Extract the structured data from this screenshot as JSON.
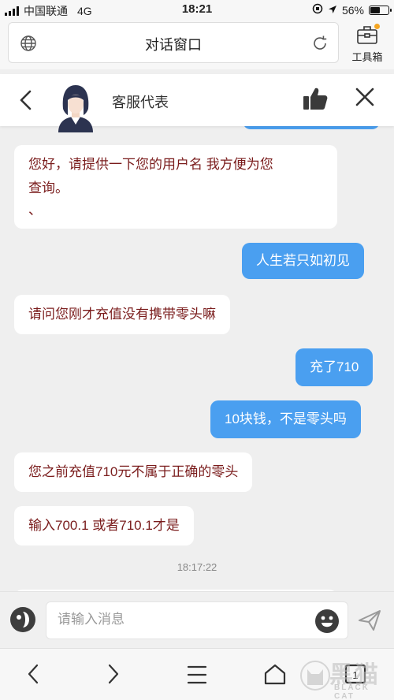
{
  "status_bar": {
    "carrier": "中国联通",
    "network": "4G",
    "time": "18:21",
    "battery": "56%",
    "battery_level": 0.56
  },
  "browser": {
    "title": "对话窗口",
    "toolbox_label": "工具箱"
  },
  "chat_header": {
    "agent_name": "客服代表"
  },
  "messages": [
    {
      "sender": "agent",
      "lines": [
        "您好，请提供一下您的用户名 我方便为您",
        "查询。",
        "、"
      ]
    },
    {
      "sender": "user",
      "text": "人生若只如初见"
    },
    {
      "sender": "agent",
      "text": "请问您刚才充值没有携带零头嘛"
    },
    {
      "sender": "user",
      "text": "充了710"
    },
    {
      "sender": "user",
      "text": "10块钱，不是零头吗"
    },
    {
      "sender": "agent",
      "text": "您之前充值710元不属于正确的零头"
    },
    {
      "sender": "agent",
      "text": "输入700.1 或者710.1才是"
    }
  ],
  "timestamp": "18:17:22",
  "input": {
    "placeholder": "请输入消息"
  },
  "watermark": {
    "cn": "黑猫",
    "en": "BLACK CAT"
  },
  "colors": {
    "user_bubble": "#4a9ff0",
    "agent_text": "#7a1c1c"
  }
}
